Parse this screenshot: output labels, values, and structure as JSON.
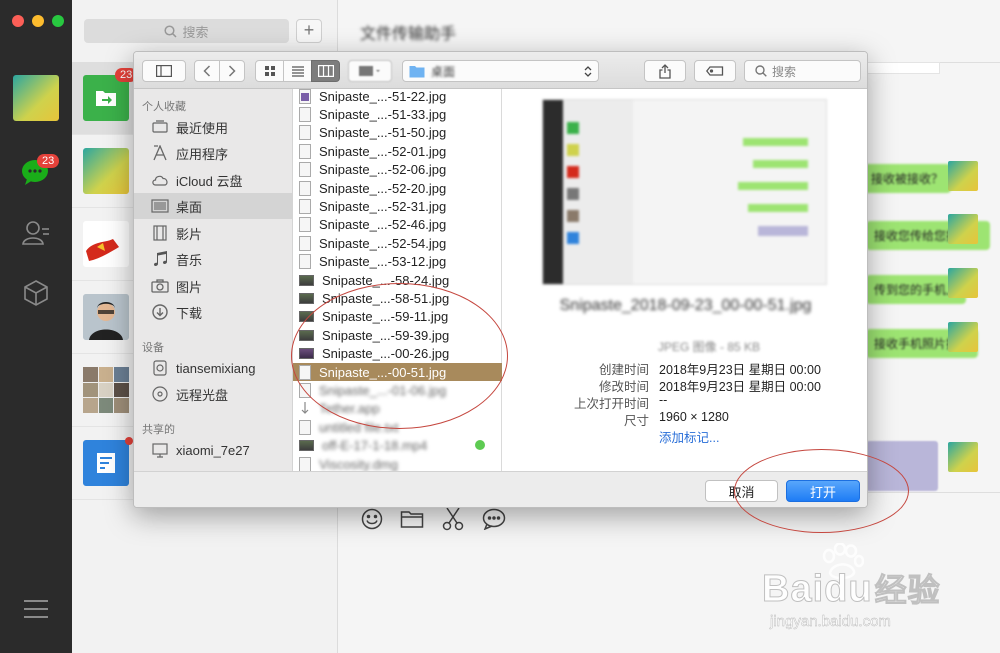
{
  "wechat": {
    "search_placeholder": "搜索",
    "add_button": "+",
    "rail_badge": "23",
    "list_badge": "23",
    "chat_title": "文件传输助手",
    "bubbles": [
      "接收被接收？",
      "接收您传给您接收？",
      "传到您的手机上",
      "接收手机照片接收"
    ]
  },
  "finder": {
    "location": "桌面",
    "search_placeholder": "搜索",
    "sidebar": {
      "favorites_title": "个人收藏",
      "favorites": [
        {
          "label": "最近使用",
          "icon": "recent-icon"
        },
        {
          "label": "应用程序",
          "icon": "applications-icon"
        },
        {
          "label": "iCloud 云盘",
          "icon": "cloud-icon"
        },
        {
          "label": "桌面",
          "icon": "desktop-icon"
        },
        {
          "label": "影片",
          "icon": "movies-icon"
        },
        {
          "label": "音乐",
          "icon": "music-icon"
        },
        {
          "label": "图片",
          "icon": "pictures-icon"
        },
        {
          "label": "下载",
          "icon": "downloads-icon"
        }
      ],
      "devices_title": "设备",
      "devices": [
        {
          "label": "tiansemixiang",
          "icon": "disk-icon"
        },
        {
          "label": "远程光盘",
          "icon": "optical-disc-icon"
        }
      ],
      "shared_title": "共享的",
      "shared": [
        {
          "label": "xiaomi_7e27",
          "icon": "computer-icon"
        }
      ]
    },
    "files": [
      "Snipaste_...-51-22.jpg",
      "Snipaste_...-51-33.jpg",
      "Snipaste_...-51-50.jpg",
      "Snipaste_...-52-01.jpg",
      "Snipaste_...-52-06.jpg",
      "Snipaste_...-52-20.jpg",
      "Snipaste_...-52-31.jpg",
      "Snipaste_...-52-46.jpg",
      "Snipaste_...-52-54.jpg",
      "Snipaste_...-53-12.jpg",
      "Snipaste_...-58-24.jpg",
      "Snipaste_...-58-51.jpg",
      "Snipaste_...-59-11.jpg",
      "Snipaste_...-59-39.jpg",
      "Snipaste_...-00-26.jpg",
      "Snipaste_...-00-51.jpg",
      "Snipaste_...-01-06.jpg",
      "Tether.app",
      "untitled file.txt",
      "off-E-17-1-18.mp4",
      "Viscosity.dmg"
    ],
    "selected_file_index": 15,
    "preview": {
      "filename": "Snipaste_2018-09-23_00-00-51.jpg",
      "kind": "JPEG 图像 - 85 KB",
      "meta": [
        {
          "key": "创建时间",
          "value": "2018年9月23日 星期日 00:00"
        },
        {
          "key": "修改时间",
          "value": "2018年9月23日 星期日 00:00"
        },
        {
          "key": "上次打开时间",
          "value": "--"
        },
        {
          "key": "尺寸",
          "value": "1960 × 1280"
        }
      ],
      "add_tags": "添加标记..."
    },
    "cancel_label": "取消",
    "open_label": "打开"
  },
  "watermark": {
    "brand": "Bai",
    "brand2": "du",
    "brand_cn": "经验",
    "url": "jingyan.baidu.com"
  },
  "colors": {
    "accent_blue": "#1e7cf5",
    "selection": "#a88a5c",
    "annotation_red": "#c5473f",
    "wechat_green": "#9de472"
  }
}
